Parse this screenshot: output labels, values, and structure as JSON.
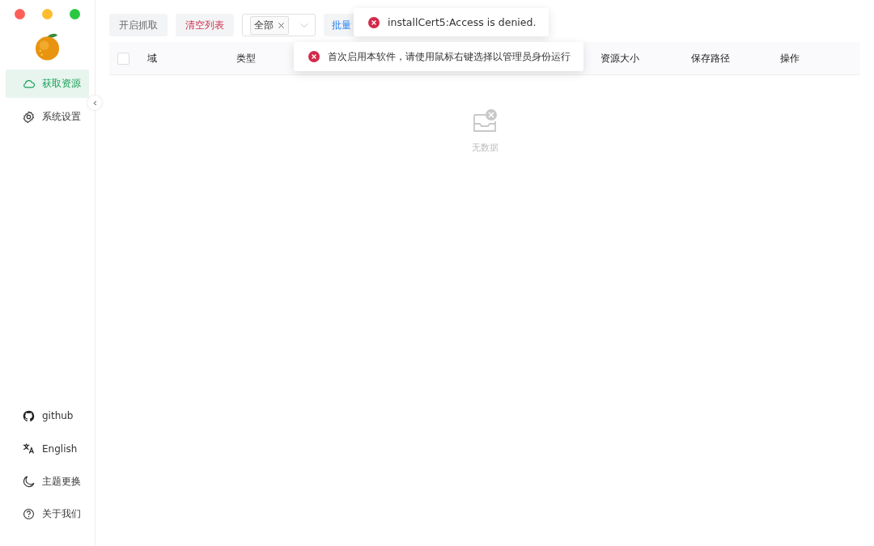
{
  "sidebar": {
    "nav": [
      {
        "label": "获取资源",
        "selected": true
      },
      {
        "label": "系统设置",
        "selected": false
      }
    ],
    "footer": [
      {
        "label": "github"
      },
      {
        "label": "English"
      },
      {
        "label": "主题更换"
      },
      {
        "label": "关于我们"
      }
    ]
  },
  "toolbar": {
    "start_button": "开启抓取",
    "clear_button": "清空列表",
    "filter": {
      "tag": "全部"
    },
    "batch_button": "批量"
  },
  "table": {
    "select_all": {
      "checked": false
    },
    "columns": [
      "域",
      "类型",
      "资源大小",
      "保存路径",
      "操作"
    ],
    "empty_text": "无数据"
  },
  "toasts": [
    {
      "kind": "error",
      "message": "installCert5:Access is denied."
    },
    {
      "kind": "error",
      "message": "首次启用本软件，请使用鼠标右键选择以管理员身份运行"
    }
  ]
}
